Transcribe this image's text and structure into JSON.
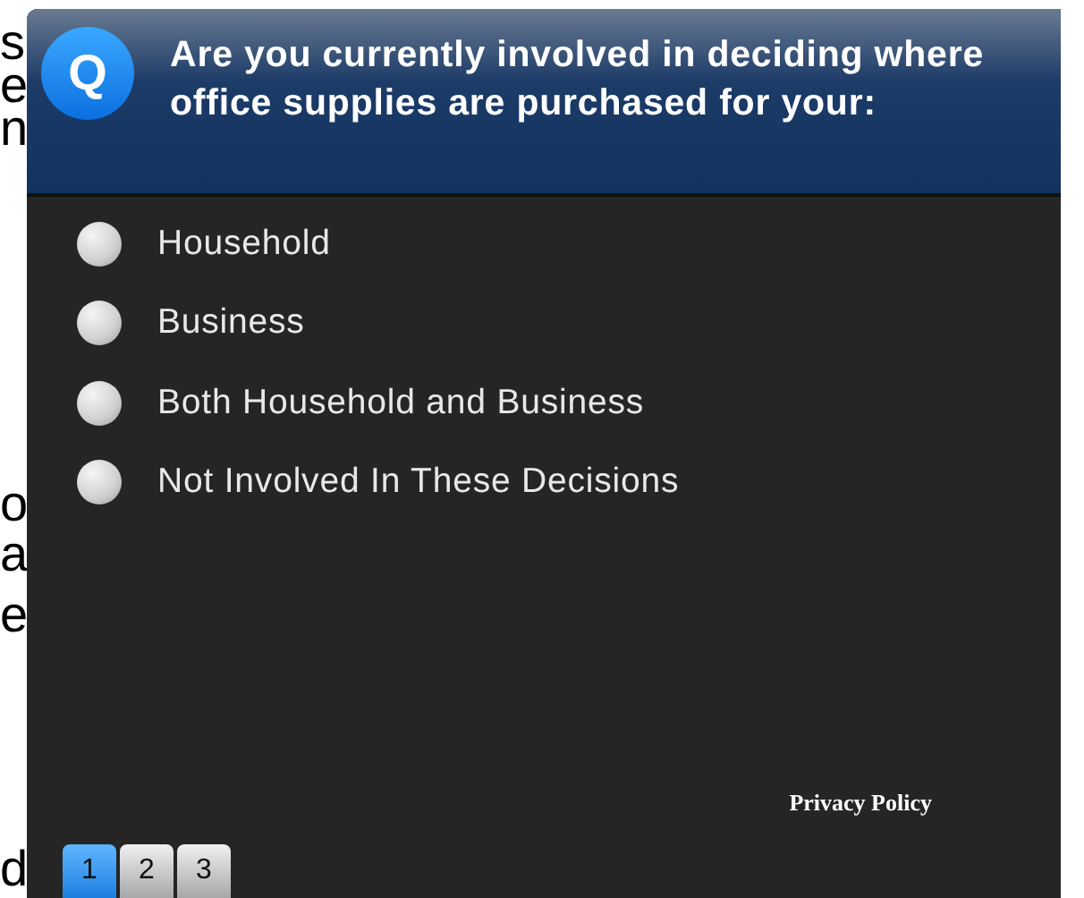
{
  "background_text": [
    "s",
    "e",
    "n",
    "o",
    "a",
    "e",
    "d"
  ],
  "question": {
    "badge": "Q",
    "lines": [
      "Are you currently involved in deciding where",
      "office supplies are purchased for your:"
    ]
  },
  "options": [
    {
      "label": "Household",
      "selected": false
    },
    {
      "label": "Business",
      "selected": false
    },
    {
      "label": "Both Household and Business",
      "selected": false
    },
    {
      "label": "Not Involved In These Decisions",
      "selected": false
    }
  ],
  "privacy_link": "Privacy Policy",
  "pages": [
    {
      "label": "1",
      "selected": true
    },
    {
      "label": "2",
      "selected": false
    },
    {
      "label": "3",
      "selected": false
    }
  ]
}
